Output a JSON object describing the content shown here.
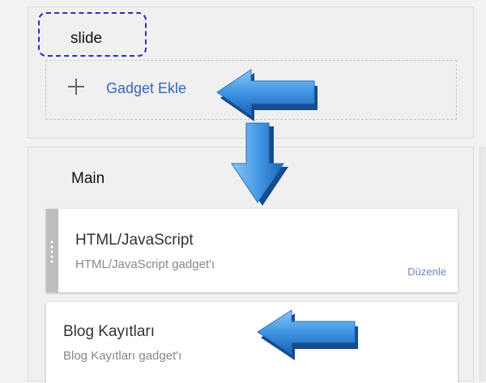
{
  "sections": {
    "slide": {
      "title": "slide",
      "add_gadget_label": "Gadget Ekle"
    },
    "main": {
      "title": "Main",
      "gadgets": [
        {
          "title": "HTML/JavaScript",
          "subtitle": "HTML/JavaScript gadget'ı",
          "edit_label": "Düzenle"
        },
        {
          "title": "Blog Kayıtları",
          "subtitle": "Blog Kayıtları gadget'ı"
        }
      ]
    }
  },
  "colors": {
    "link": "#3467b9",
    "highlight_border": "#2b2fb3",
    "arrow": "#3f95e3"
  },
  "icons": {
    "add": "plus-icon",
    "drag": "drag-handle-icon",
    "annotation": "blue-arrow-icon"
  }
}
